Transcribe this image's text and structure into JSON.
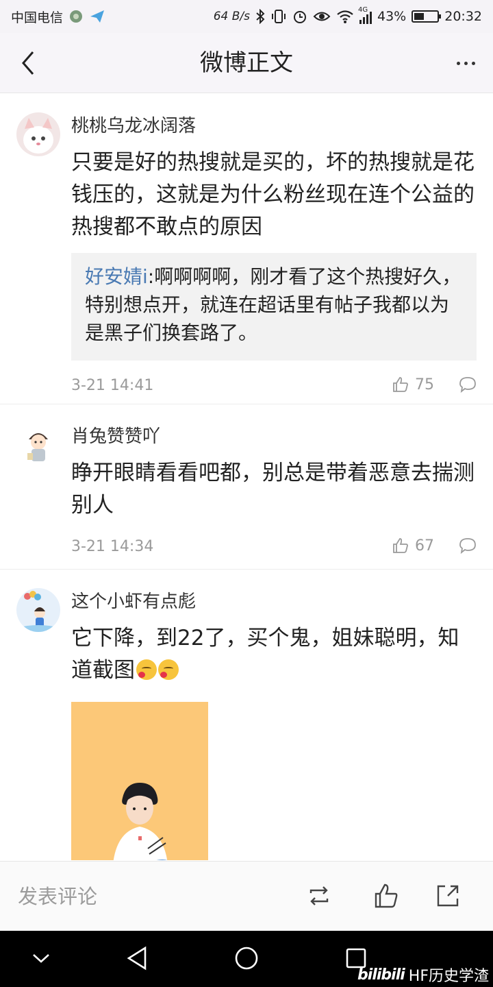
{
  "status_bar": {
    "carrier": "中国电信",
    "speed": "64 B/s",
    "network": "4G",
    "battery": "43%",
    "battery_level": 0.43,
    "time": "20:32"
  },
  "header": {
    "title": "微博正文"
  },
  "comments": [
    {
      "username": "桃桃乌龙冰阔落",
      "text": "只要是好的热搜就是买的，坏的热搜就是花钱压的，这就是为什么粉丝现在连个公益的热搜都不敢点的原因",
      "reply": {
        "user": "好安婧i",
        "text": ":啊啊啊啊，刚才看了这个热搜好久，特别想点开，就连在超话里有帖子我都以为是黑子们换套路了。"
      },
      "time": "3-21 14:41",
      "likes": "75"
    },
    {
      "username": "肖兔赞赞吖",
      "text": "睁开眼睛看看吧都，别总是带着恶意去揣测别人",
      "time": "3-21 14:34",
      "likes": "67"
    },
    {
      "username": "这个小虾有点彪",
      "text": "它下降，到22了，买个鬼，姐妹聪明，知道截图"
    }
  ],
  "bottom_bar": {
    "comment_placeholder": "发表评论"
  },
  "watermark": {
    "logo": "bilibili",
    "text": "HF历史学渣"
  },
  "colors": {
    "reply_user": "#4a7ab3",
    "meta_text": "#9a9a9a",
    "image_bg": "#fcc878"
  },
  "icons": [
    "back-icon",
    "more-icon",
    "like-icon",
    "comment-icon",
    "repost-icon",
    "share-icon"
  ]
}
